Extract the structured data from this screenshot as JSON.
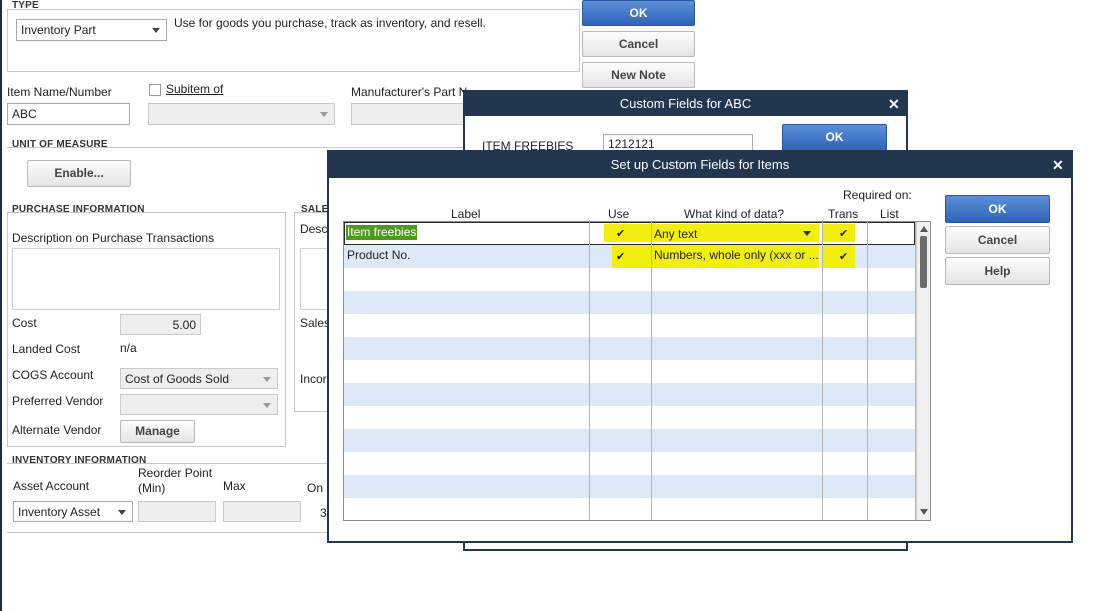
{
  "item_form": {
    "type_section": "TYPE",
    "type_value": "Inventory Part",
    "type_description": "Use for goods you purchase, track as inventory, and resell.",
    "item_name_label": "Item Name/Number",
    "item_name_value": "ABC",
    "subitem_label": "Subitem of",
    "mfr_part_label": "Manufacturer's Part N",
    "uom_section": "UNIT OF MEASURE",
    "enable_button": "Enable...",
    "purchase_section": "PURCHASE INFORMATION",
    "purchase_desc_label": "Description on Purchase Transactions",
    "sales_section": "SALE",
    "sales_desc_label": "Desc",
    "sales_price_label": "Sales",
    "income_label": "Incor",
    "cost_label": "Cost",
    "cost_value": "5.00",
    "landed_cost_label": "Landed Cost",
    "landed_cost_value": "n/a",
    "cogs_label": "COGS Account",
    "cogs_value": "Cost of Goods Sold",
    "pref_vendor_label": "Preferred Vendor",
    "alt_vendor_label": "Alternate Vendor",
    "manage_button": "Manage",
    "inventory_section": "INVENTORY INFORMATION",
    "asset_account_label": "Asset Account",
    "reorder_label_1": "Reorder Point",
    "reorder_label_2": "(Min)",
    "max_label": "Max",
    "on_hand_label": "On",
    "asset_value": "Inventory Asset",
    "on_hand_value": "3"
  },
  "side_buttons": {
    "ok": "OK",
    "cancel": "Cancel",
    "new_note": "New Note"
  },
  "custom_fields_dialog": {
    "title": "Custom Fields for ABC",
    "field_label": "ITEM FREEBIES",
    "field_value": "1212121",
    "ok": "OK"
  },
  "setup_dialog": {
    "title": "Set up Custom Fields for Items",
    "required_on": "Required on:",
    "columns": {
      "label": "Label",
      "use": "Use",
      "kind": "What kind of data?",
      "trans": "Trans",
      "list": "List"
    },
    "rows": [
      {
        "label": "Item freebies",
        "use": "✔",
        "kind": "Any text",
        "trans": "✔",
        "list": ""
      },
      {
        "label": "Product No.",
        "use": "✔",
        "kind": "Numbers, whole only (xxx or ...",
        "trans": "✔",
        "list": ""
      }
    ],
    "buttons": {
      "ok": "OK",
      "cancel": "Cancel",
      "help": "Help"
    }
  },
  "colors": {
    "title_bar": "#23364f",
    "primary_button": "#2f64b8",
    "highlight": "#f2ee0f",
    "selection": "#4e9a1f",
    "alt_row": "#dde9f7"
  }
}
